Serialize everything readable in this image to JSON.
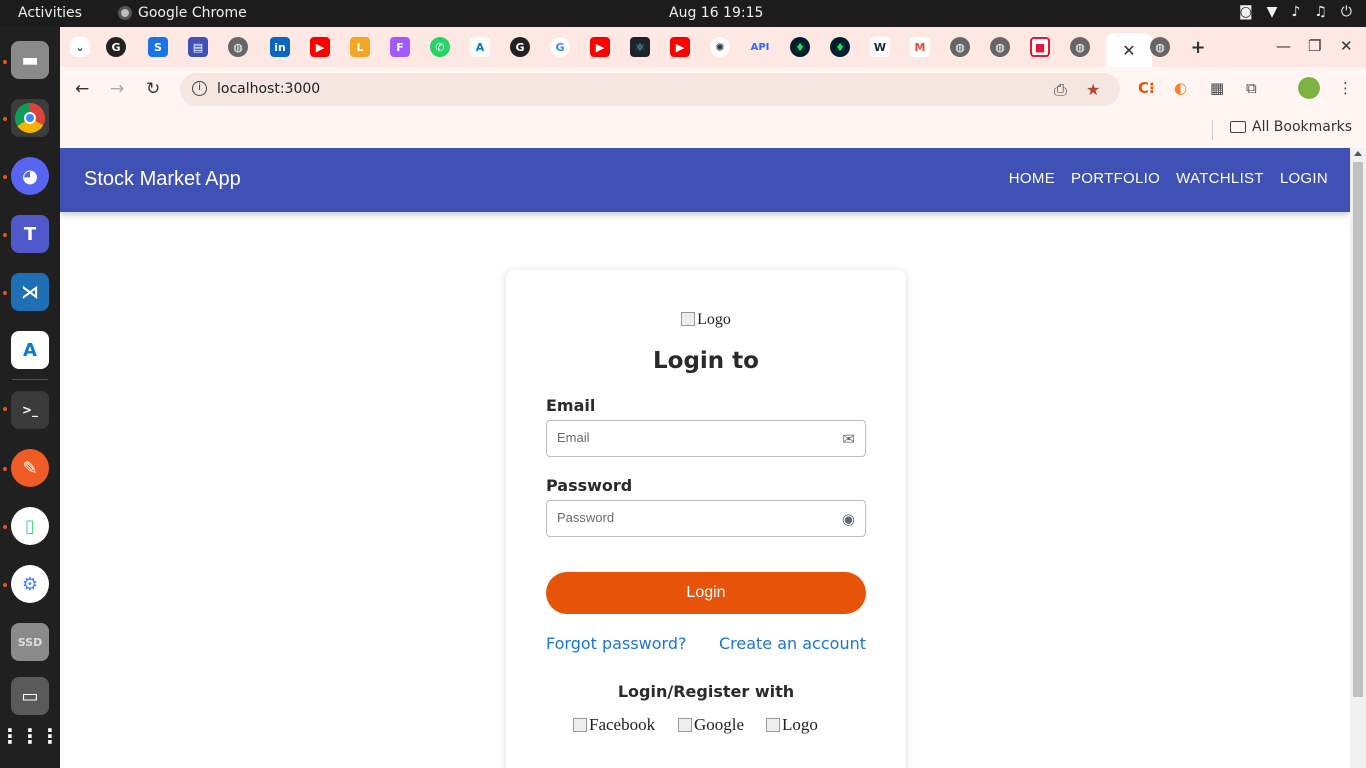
{
  "topbar": {
    "activities": "Activities",
    "app_name": "Google Chrome",
    "clock": "Aug 16  19:15"
  },
  "browser": {
    "url": "localhost:3000",
    "all_bookmarks": "All Bookmarks"
  },
  "app": {
    "brand": "Stock Market App",
    "nav": [
      "HOME",
      "PORTFOLIO",
      "WATCHLIST",
      "LOGIN"
    ]
  },
  "login": {
    "logo_alt": "Logo",
    "title": "Login to",
    "email_label": "Email",
    "email_placeholder": "Email",
    "password_label": "Password",
    "password_placeholder": "Password",
    "login_button": "Login",
    "forgot": "Forgot password?",
    "create": "Create an account",
    "social_title": "Login/Register with",
    "social": [
      "Facebook",
      "Google",
      "Logo"
    ]
  }
}
